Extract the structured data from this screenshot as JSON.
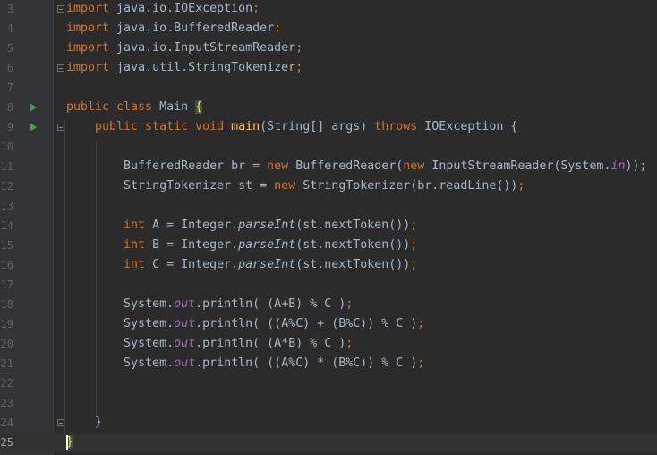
{
  "editor": {
    "language": "java",
    "current_line": "25",
    "lines": [
      {
        "num": "3",
        "tokens": [
          {
            "t": "import",
            "c": "kw"
          },
          {
            "t": " java.io.IOException"
          },
          {
            "t": ";",
            "c": "kw"
          }
        ]
      },
      {
        "num": "4",
        "tokens": [
          {
            "t": "import",
            "c": "kw"
          },
          {
            "t": " java.io.BufferedReader"
          },
          {
            "t": ";",
            "c": "kw"
          }
        ]
      },
      {
        "num": "5",
        "tokens": [
          {
            "t": "import",
            "c": "kw"
          },
          {
            "t": " java.io.InputStreamReader"
          },
          {
            "t": ";",
            "c": "kw"
          }
        ]
      },
      {
        "num": "6",
        "tokens": [
          {
            "t": "import",
            "c": "kw"
          },
          {
            "t": " java.util.StringTokenizer"
          },
          {
            "t": ";",
            "c": "kw"
          }
        ]
      },
      {
        "num": "7",
        "tokens": []
      },
      {
        "num": "8",
        "tokens": [
          {
            "t": "public class ",
            "c": "kw"
          },
          {
            "t": "Main "
          },
          {
            "t": "{",
            "c": "brace-hl"
          }
        ]
      },
      {
        "num": "9",
        "tokens": [
          {
            "t": "    public static void ",
            "c": "kw"
          },
          {
            "t": "main",
            "c": "fn"
          },
          {
            "t": "(String[] args) "
          },
          {
            "t": "throws ",
            "c": "kw"
          },
          {
            "t": "IOException {"
          }
        ]
      },
      {
        "num": "10",
        "tokens": []
      },
      {
        "num": "11",
        "tokens": [
          {
            "t": "        BufferedReader br = "
          },
          {
            "t": "new ",
            "c": "kw"
          },
          {
            "t": "BufferedReader("
          },
          {
            "t": "new ",
            "c": "kw"
          },
          {
            "t": "InputStreamReader(System."
          },
          {
            "t": "in",
            "c": "st"
          },
          {
            "t": "));"
          }
        ]
      },
      {
        "num": "12",
        "tokens": [
          {
            "t": "        StringTokenizer st = "
          },
          {
            "t": "new ",
            "c": "kw"
          },
          {
            "t": "StringTokenizer(br.readLine())"
          },
          {
            "t": ";",
            "c": "kw"
          }
        ]
      },
      {
        "num": "13",
        "tokens": []
      },
      {
        "num": "14",
        "tokens": [
          {
            "t": "        int ",
            "c": "kw"
          },
          {
            "t": "A = Integer."
          },
          {
            "t": "parseInt",
            "c": "it"
          },
          {
            "t": "(st.nextToken())"
          },
          {
            "t": ";",
            "c": "kw"
          }
        ]
      },
      {
        "num": "15",
        "tokens": [
          {
            "t": "        int ",
            "c": "kw"
          },
          {
            "t": "B = Integer."
          },
          {
            "t": "parseInt",
            "c": "it"
          },
          {
            "t": "(st.nextToken())"
          },
          {
            "t": ";",
            "c": "kw"
          }
        ]
      },
      {
        "num": "16",
        "tokens": [
          {
            "t": "        int ",
            "c": "kw"
          },
          {
            "t": "C = Integer."
          },
          {
            "t": "parseInt",
            "c": "it"
          },
          {
            "t": "(st.nextToken())"
          },
          {
            "t": ";",
            "c": "kw"
          }
        ]
      },
      {
        "num": "17",
        "tokens": []
      },
      {
        "num": "18",
        "tokens": [
          {
            "t": "        System."
          },
          {
            "t": "out",
            "c": "st"
          },
          {
            "t": ".println( (A+B) % C )"
          },
          {
            "t": ";",
            "c": "kw"
          }
        ]
      },
      {
        "num": "19",
        "tokens": [
          {
            "t": "        System."
          },
          {
            "t": "out",
            "c": "st"
          },
          {
            "t": ".println( ((A%C) + (B%C)) % C )"
          },
          {
            "t": ";",
            "c": "kw"
          }
        ]
      },
      {
        "num": "20",
        "tokens": [
          {
            "t": "        System."
          },
          {
            "t": "out",
            "c": "st"
          },
          {
            "t": ".println( (A*B) % C )"
          },
          {
            "t": ";",
            "c": "kw"
          }
        ]
      },
      {
        "num": "21",
        "tokens": [
          {
            "t": "        System."
          },
          {
            "t": "out",
            "c": "st"
          },
          {
            "t": ".println( ((A%C) * (B%C)) % C )"
          },
          {
            "t": ";",
            "c": "kw"
          }
        ]
      },
      {
        "num": "22",
        "tokens": []
      },
      {
        "num": "23",
        "tokens": []
      },
      {
        "num": "24",
        "tokens": [
          {
            "t": "    }"
          }
        ]
      },
      {
        "num": "25",
        "tokens": [
          {
            "t": "}",
            "c": "brace-hl"
          }
        ]
      }
    ],
    "gutter_icons": [
      {
        "line": "8",
        "icon": "run-icon"
      },
      {
        "line": "9",
        "icon": "run-icon"
      }
    ],
    "fold_markers": [
      "3",
      "6",
      "9",
      "24"
    ],
    "colors": {
      "background": "#2b2b2b",
      "gutter": "#313335",
      "keyword": "#cc7832",
      "text": "#a9b7c6",
      "method": "#ffc66d",
      "static_field": "#9876aa",
      "line_number": "#606366",
      "run_icon": "#499c54",
      "brace_match": "#ffef28"
    }
  }
}
